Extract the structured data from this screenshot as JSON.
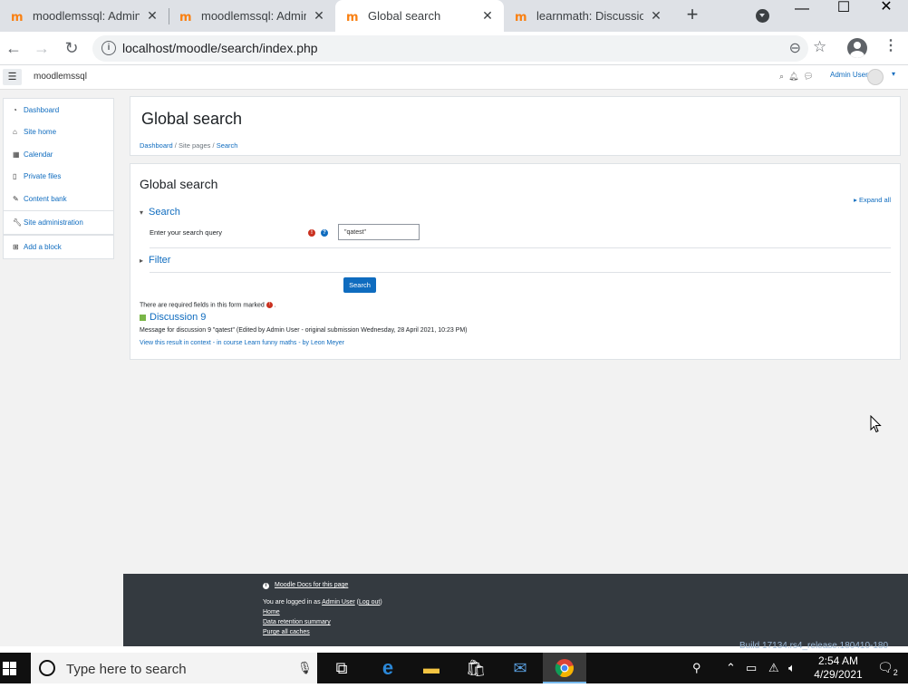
{
  "browser": {
    "tabs": [
      {
        "title": "moodlemssql: Adminis",
        "active": false
      },
      {
        "title": "moodlemssql: Adminis",
        "active": false
      },
      {
        "title": "Global search",
        "active": true
      },
      {
        "title": "learnmath: Discussion",
        "active": false
      }
    ],
    "url": "localhost/moodle/search/index.php"
  },
  "navbar": {
    "site_name": "moodlemssql",
    "user_name": "Admin User"
  },
  "drawer": {
    "items": [
      {
        "label": "Dashboard",
        "icon": "dashboard-icon"
      },
      {
        "label": "Site home",
        "icon": "home-icon"
      },
      {
        "label": "Calendar",
        "icon": "calendar-icon"
      },
      {
        "label": "Private files",
        "icon": "file-icon"
      },
      {
        "label": "Content bank",
        "icon": "brush-icon"
      }
    ],
    "site_admin": {
      "label": "Site administration",
      "icon": "wrench-icon"
    },
    "add_block": {
      "label": "Add a block",
      "icon": "plus-square-icon"
    }
  },
  "header": {
    "title": "Global search",
    "breadcrumb": [
      "Dashboard",
      "Site pages",
      "Search"
    ]
  },
  "main": {
    "heading": "Global search",
    "expand_all": "Expand all",
    "search_section": "Search",
    "query_label": "Enter your search query",
    "query_value": "\"qatest\"",
    "filter_section": "Filter",
    "search_button": "Search",
    "required_note": "There are required fields in this form marked",
    "required_note_end": ".",
    "result": {
      "title": "Discussion 9",
      "description": "Message for discussion 9 \"qatest\" (Edited by Admin User - original submission Wednesday, 28 April 2021, 10:23 PM)",
      "context_link": "View this result in context",
      "sep1": " - ",
      "course_link": "in course Learn funny maths",
      "sep2": " - ",
      "author_link": "by Leon Meyer"
    }
  },
  "footer": {
    "docs_link": "Moodle Docs for this page",
    "logged_in_prefix": "You are logged in as ",
    "logged_in_user": "Admin User",
    "logout": "Log out",
    "home": "Home",
    "data_retention": "Data retention summary",
    "purge": "Purge all caches",
    "build": "Build 17134.rs4_release.180410-180"
  },
  "taskbar": {
    "search_placeholder": "Type here to search",
    "time": "2:54 AM",
    "date": "4/29/2021",
    "notification_count": "2"
  },
  "colors": {
    "link": "#0f6cbf",
    "footer_bg": "#343a40",
    "required": "#ca3120"
  }
}
